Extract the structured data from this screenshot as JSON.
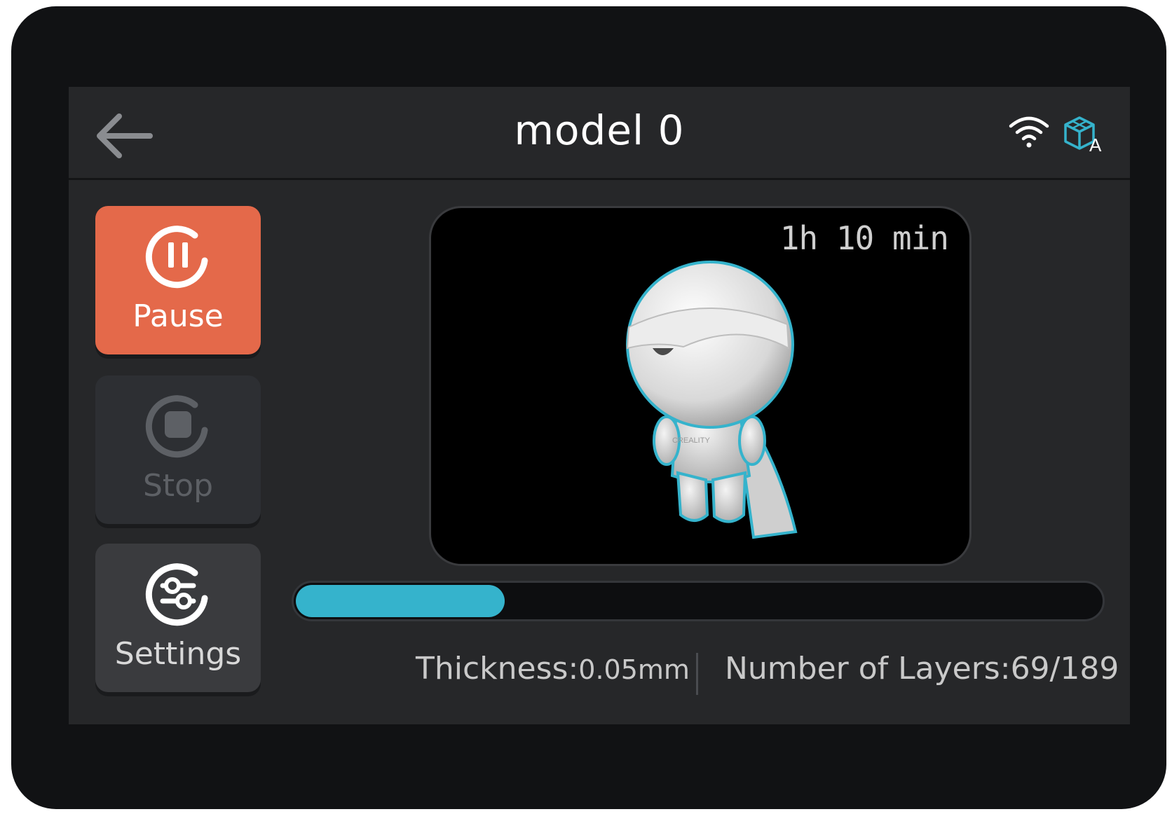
{
  "header": {
    "title": "model 0",
    "back_icon": "arrow-left-icon",
    "wifi_icon": "wifi-icon",
    "model_icon": "cube-auto-icon",
    "model_icon_letter": "A"
  },
  "sidebar": {
    "pause_label": "Pause",
    "stop_label": "Stop",
    "settings_label": "Settings"
  },
  "preview": {
    "time_remaining": "1h 10 min",
    "chest_text": "CREALITY"
  },
  "progress": {
    "fraction": 0.26
  },
  "stats": {
    "thickness_label": "Thickness:",
    "thickness_value": "0.05mm",
    "layers_label": "Number of Layers:",
    "layers_value": "69/189"
  },
  "colors": {
    "accent": "#e4694a",
    "progress": "#35b3cc",
    "background": "#262729",
    "bezel": "#111214"
  }
}
